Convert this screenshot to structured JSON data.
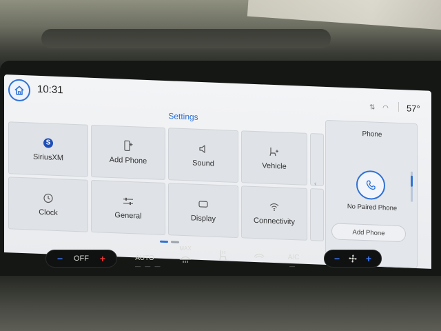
{
  "status_bar": {
    "time": "10:31",
    "temperature": "57°"
  },
  "settings": {
    "title": "Settings",
    "tiles": [
      {
        "label": "SiriusXM",
        "icon": "siriusxm-icon"
      },
      {
        "label": "Add Phone",
        "icon": "phone-add-icon"
      },
      {
        "label": "Sound",
        "icon": "speaker-icon"
      },
      {
        "label": "Vehicle",
        "icon": "vehicle-seat-icon"
      },
      {
        "label": "Clock",
        "icon": "clock-icon"
      },
      {
        "label": "General",
        "icon": "sliders-icon"
      },
      {
        "label": "Display",
        "icon": "display-icon"
      },
      {
        "label": "Connectivity",
        "icon": "wifi-icon"
      }
    ]
  },
  "phone_panel": {
    "title": "Phone",
    "status": "No Paired Phone",
    "button": "Add Phone"
  },
  "climate": {
    "fan_minus": "−",
    "fan_off": "OFF",
    "fan_plus": "+",
    "auto": "AUTO",
    "max": "MAX",
    "ac": "A/C",
    "right_minus": "−",
    "right_plus": "+"
  },
  "colors": {
    "accent": "#2f72d6",
    "heat_red": "#ff3a3a",
    "cool_blue": "#3f7dff"
  }
}
